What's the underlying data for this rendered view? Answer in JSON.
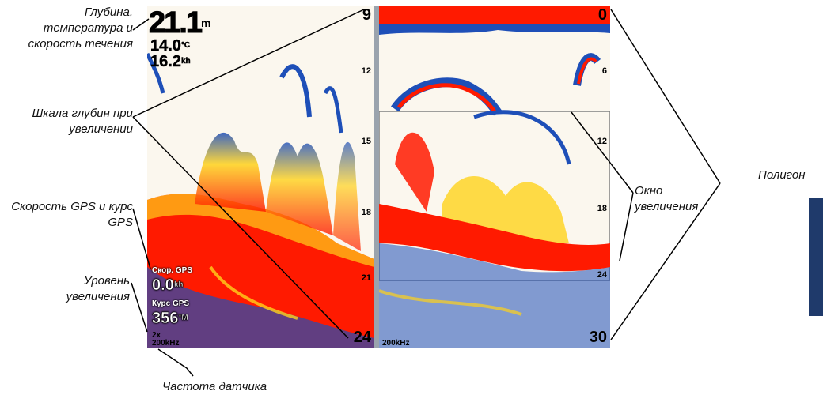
{
  "callouts": {
    "depth_temp_speed": "Глубина, температура и скорость течения",
    "depth_scale": "Шкала глубин при увеличении",
    "gps_speed_course": "Скорость GPS и курс GPS",
    "zoom_level": "Уровень увеличения",
    "transducer_freq": "Частота датчика",
    "zoom_window": "Окно увеличения",
    "polygon": "Полигон"
  },
  "left_pane": {
    "depth_value": "21.1",
    "depth_unit": "m",
    "temp_value": "14.0",
    "temp_unit": "°C",
    "speed_value": "16.2",
    "speed_unit": "kh",
    "scale_top": "9",
    "scale_marks": [
      "12",
      "15",
      "18",
      "21"
    ],
    "scale_bottom": "24",
    "gps_speed_label": "Скор. GPS",
    "gps_speed_value": "0.0",
    "gps_speed_unit": "kh",
    "gps_course_label": "Курс GPS",
    "gps_course_value": "356",
    "gps_course_unit": "°M",
    "zoom_level": "2x",
    "frequency": "200kHz"
  },
  "right_pane": {
    "scale_top": "0",
    "scale_marks": [
      "6",
      "12",
      "18",
      "24"
    ],
    "scale_bottom": "30",
    "frequency": "200kHz"
  },
  "colors": {
    "echo_strong": "#ff1a00",
    "echo_mid": "#ffd21a",
    "echo_weak": "#1e4fb8",
    "background": "#fbf7ee",
    "side_tab": "#1f3a6b"
  }
}
